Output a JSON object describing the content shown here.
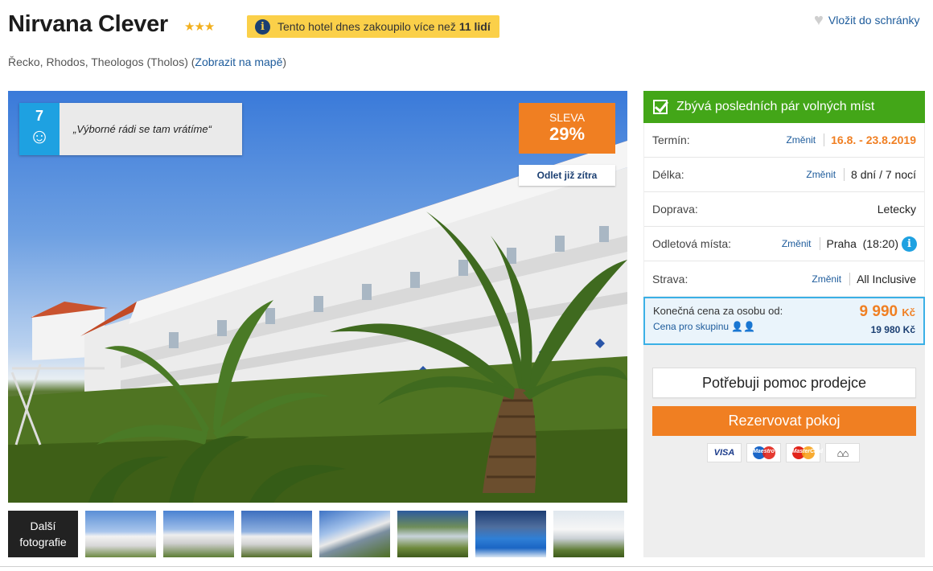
{
  "hotel": {
    "name": "Nirvana Clever",
    "stars": "★★★",
    "buyers_text": "Tento hotel dnes zakoupilo více než",
    "buyers_count": "11 lidí",
    "wishlist_label": "Vložit do schránky",
    "location_text": "Řecko, Rhodos, Theologos (Tholos) (",
    "map_link": "Zobrazit na mapě",
    "location_close": ")"
  },
  "gallery": {
    "rating_score": "7",
    "rating_quote": "„Výborné rádi se tam vrátíme“",
    "discount_label": "SLEVA",
    "discount_value": "29%",
    "departure_tag": "Odlet již zítra",
    "more_photos_line1": "Další",
    "more_photos_line2": "fotografie",
    "thumbnail_count": 7
  },
  "booking": {
    "availability": "Zbývá posledních pár volných míst",
    "change_label": "Změnit",
    "rows": [
      {
        "label": "Termín:",
        "value": "16.8. - 23.8.2019"
      },
      {
        "label": "Délka:",
        "value": "8 dní / 7 nocí"
      },
      {
        "label": "Doprava:",
        "value": "Letecky"
      },
      {
        "label": "Odletová místa:",
        "value": "Praha  (18:20)"
      },
      {
        "label": "Strava:",
        "value": "All Inclusive"
      }
    ],
    "price_label": "Konečná cena za osobu od:",
    "price_value": "9 990",
    "currency": "Kč",
    "group_label": "Cena pro skupinu",
    "group_price": "19 980 Kč",
    "help_button": "Potřebuji pomoc prodejce",
    "reserve_button": "Rezervovat pokoj",
    "payment_methods": [
      "VISA",
      "Maestro",
      "MasterCard",
      "bank-transfer-icon"
    ]
  },
  "colors": {
    "orange": "#f07f22",
    "green": "#43a618",
    "blue": "#1ea1e1",
    "navy": "#1b3f72",
    "yellow": "#fbd049"
  }
}
